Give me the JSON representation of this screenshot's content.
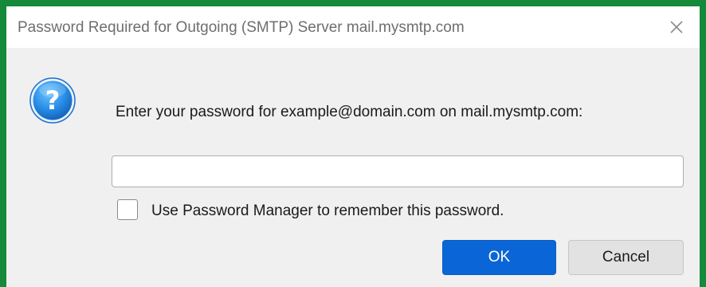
{
  "dialog": {
    "title": "Password Required for Outgoing (SMTP) Server mail.mysmtp.com",
    "prompt": "Enter your password for example@domain.com on mail.mysmtp.com:",
    "password_value": "",
    "password_placeholder": "",
    "remember_label": "Use Password Manager to remember this password.",
    "remember_checked": false,
    "ok_label": "OK",
    "cancel_label": "Cancel",
    "icons": {
      "close": "close-icon",
      "prompt": "question-icon"
    }
  },
  "colors": {
    "background": "#148a3a",
    "accent": "#0a66d6",
    "dialog": "#f0f0f0"
  }
}
